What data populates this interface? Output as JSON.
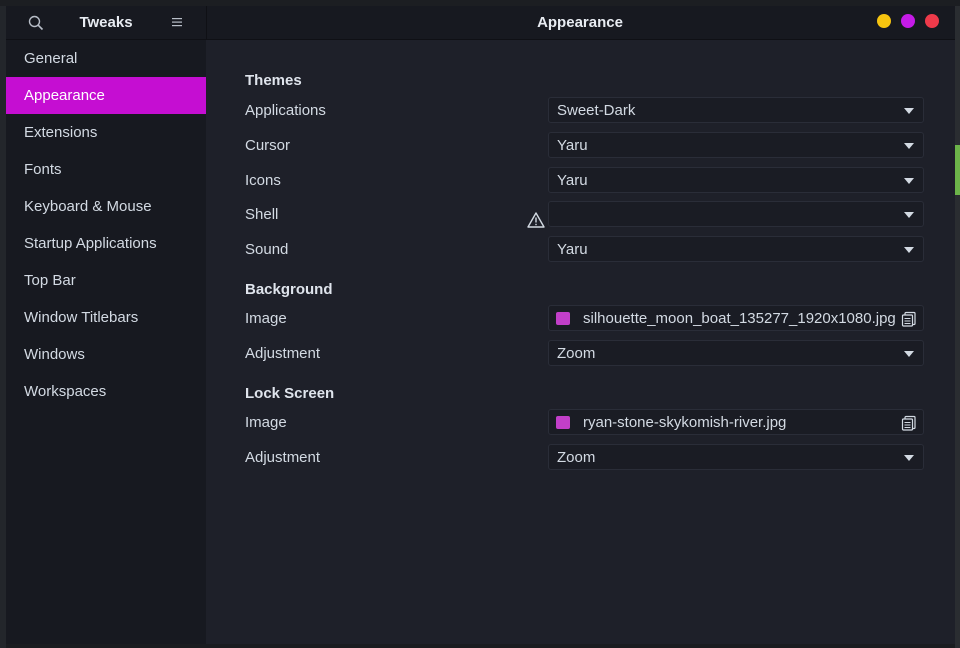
{
  "app_title": "Tweaks",
  "window_title": "Appearance",
  "sidebar": {
    "items": [
      {
        "label": "General"
      },
      {
        "label": "Appearance"
      },
      {
        "label": "Extensions"
      },
      {
        "label": "Fonts"
      },
      {
        "label": "Keyboard & Mouse"
      },
      {
        "label": "Startup Applications"
      },
      {
        "label": "Top Bar"
      },
      {
        "label": "Window Titlebars"
      },
      {
        "label": "Windows"
      },
      {
        "label": "Workspaces"
      }
    ],
    "active": "Appearance"
  },
  "themes": {
    "title": "Themes",
    "applications": {
      "label": "Applications",
      "value": "Sweet-Dark"
    },
    "cursor": {
      "label": "Cursor",
      "value": "Yaru"
    },
    "icons": {
      "label": "Icons",
      "value": "Yaru"
    },
    "shell": {
      "label": "Shell",
      "value": ""
    },
    "sound": {
      "label": "Sound",
      "value": "Yaru"
    }
  },
  "background": {
    "title": "Background",
    "image": {
      "label": "Image",
      "value": "silhouette_moon_boat_135277_1920x1080.jpg"
    },
    "adjustment": {
      "label": "Adjustment",
      "value": "Zoom"
    }
  },
  "lock_screen": {
    "title": "Lock Screen",
    "image": {
      "label": "Image",
      "value": "ryan-stone-skykomish-river.jpg"
    },
    "adjustment": {
      "label": "Adjustment",
      "value": "Zoom"
    }
  },
  "colors": {
    "accent": "#c50ed2",
    "minimize": "#f6c40f",
    "maximize": "#c51be7",
    "close": "#ee3a4a"
  }
}
